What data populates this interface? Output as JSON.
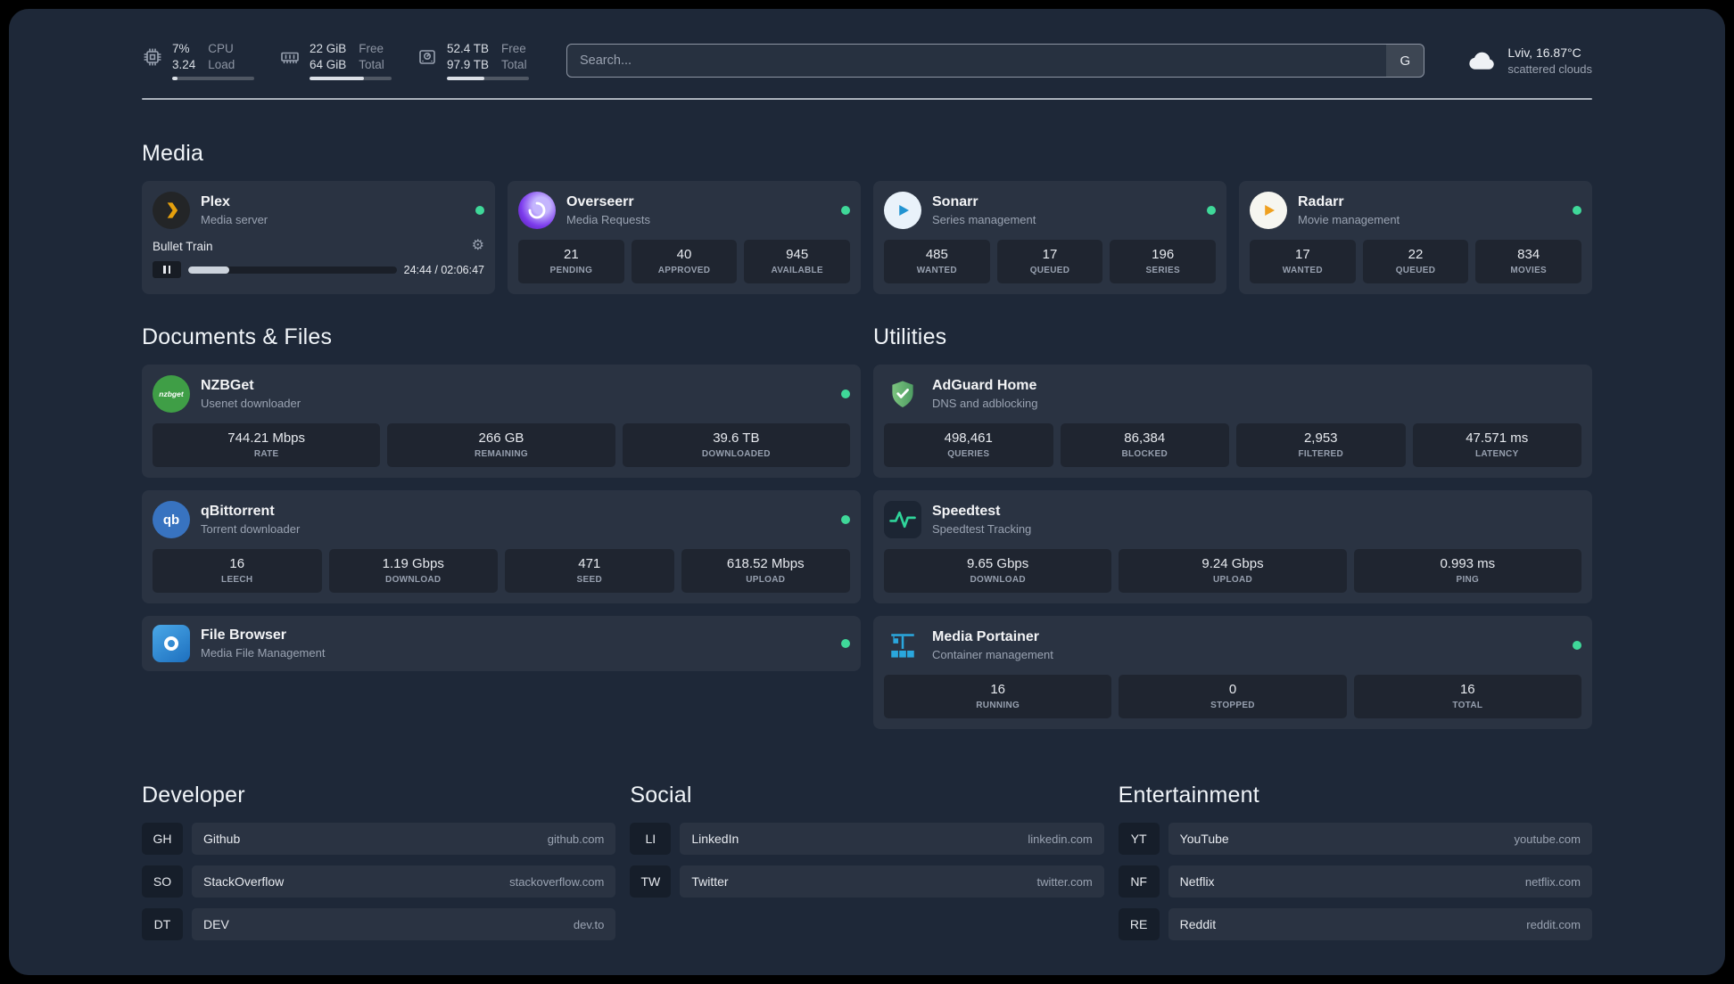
{
  "topbar": {
    "resources": [
      {
        "icon": "cpu-icon",
        "top_value": "7%",
        "bottom_value": "3.24",
        "top_label": "CPU",
        "bottom_label": "Load",
        "bar_percent": 7
      },
      {
        "icon": "memory-icon",
        "top_value": "22 GiB",
        "bottom_value": "64 GiB",
        "top_label": "Free",
        "bottom_label": "Total",
        "bar_percent": 66
      },
      {
        "icon": "disk-icon",
        "top_value": "52.4 TB",
        "bottom_value": "97.9 TB",
        "top_label": "Free",
        "bottom_label": "Total",
        "bar_percent": 46
      }
    ],
    "search": {
      "placeholder": "Search...",
      "provider_label": "G"
    },
    "weather": {
      "location_temp": "Lviv, 16.87°C",
      "condition": "scattered clouds"
    }
  },
  "sections": {
    "media": "Media",
    "documents": "Documents & Files",
    "utilities": "Utilities",
    "developer": "Developer",
    "social": "Social",
    "entertainment": "Entertainment"
  },
  "colors": {
    "status_online": "#3fd899"
  },
  "services": {
    "plex": {
      "name": "Plex",
      "subtitle": "Media server",
      "now_playing": {
        "title": "Bullet Train",
        "time": "24:44 / 02:06:47",
        "progress_percent": 19.5
      }
    },
    "overseerr": {
      "name": "Overseerr",
      "subtitle": "Media Requests",
      "stats": [
        {
          "value": "21",
          "label": "PENDING"
        },
        {
          "value": "40",
          "label": "APPROVED"
        },
        {
          "value": "945",
          "label": "AVAILABLE"
        }
      ]
    },
    "sonarr": {
      "name": "Sonarr",
      "subtitle": "Series management",
      "stats": [
        {
          "value": "485",
          "label": "WANTED"
        },
        {
          "value": "17",
          "label": "QUEUED"
        },
        {
          "value": "196",
          "label": "SERIES"
        }
      ]
    },
    "radarr": {
      "name": "Radarr",
      "subtitle": "Movie management",
      "stats": [
        {
          "value": "17",
          "label": "WANTED"
        },
        {
          "value": "22",
          "label": "QUEUED"
        },
        {
          "value": "834",
          "label": "MOVIES"
        }
      ]
    },
    "nzbget": {
      "name": "NZBGet",
      "subtitle": "Usenet downloader",
      "stats": [
        {
          "value": "744.21 Mbps",
          "label": "RATE"
        },
        {
          "value": "266 GB",
          "label": "REMAINING"
        },
        {
          "value": "39.6 TB",
          "label": "DOWNLOADED"
        }
      ]
    },
    "qbittorrent": {
      "name": "qBittorrent",
      "subtitle": "Torrent downloader",
      "stats": [
        {
          "value": "16",
          "label": "LEECH"
        },
        {
          "value": "1.19 Gbps",
          "label": "DOWNLOAD"
        },
        {
          "value": "471",
          "label": "SEED"
        },
        {
          "value": "618.52 Mbps",
          "label": "UPLOAD"
        }
      ]
    },
    "filebrowser": {
      "name": "File Browser",
      "subtitle": "Media File Management"
    },
    "adguard": {
      "name": "AdGuard Home",
      "subtitle": "DNS and adblocking",
      "stats": [
        {
          "value": "498,461",
          "label": "QUERIES"
        },
        {
          "value": "86,384",
          "label": "BLOCKED"
        },
        {
          "value": "2,953",
          "label": "FILTERED"
        },
        {
          "value": "47.571 ms",
          "label": "LATENCY"
        }
      ]
    },
    "speedtest": {
      "name": "Speedtest",
      "subtitle": "Speedtest Tracking",
      "stats": [
        {
          "value": "9.65 Gbps",
          "label": "DOWNLOAD"
        },
        {
          "value": "9.24 Gbps",
          "label": "UPLOAD"
        },
        {
          "value": "0.993 ms",
          "label": "PING"
        }
      ]
    },
    "portainer": {
      "name": "Media Portainer",
      "subtitle": "Container management",
      "stats": [
        {
          "value": "16",
          "label": "RUNNING"
        },
        {
          "value": "0",
          "label": "STOPPED"
        },
        {
          "value": "16",
          "label": "TOTAL"
        }
      ]
    }
  },
  "bookmarks": {
    "developer": [
      {
        "abbr": "GH",
        "name": "Github",
        "domain": "github.com"
      },
      {
        "abbr": "SO",
        "name": "StackOverflow",
        "domain": "stackoverflow.com"
      },
      {
        "abbr": "DT",
        "name": "DEV",
        "domain": "dev.to"
      }
    ],
    "social": [
      {
        "abbr": "LI",
        "name": "LinkedIn",
        "domain": "linkedin.com"
      },
      {
        "abbr": "TW",
        "name": "Twitter",
        "domain": "twitter.com"
      }
    ],
    "entertainment": [
      {
        "abbr": "YT",
        "name": "YouTube",
        "domain": "youtube.com"
      },
      {
        "abbr": "NF",
        "name": "Netflix",
        "domain": "netflix.com"
      },
      {
        "abbr": "RE",
        "name": "Reddit",
        "domain": "reddit.com"
      }
    ]
  }
}
